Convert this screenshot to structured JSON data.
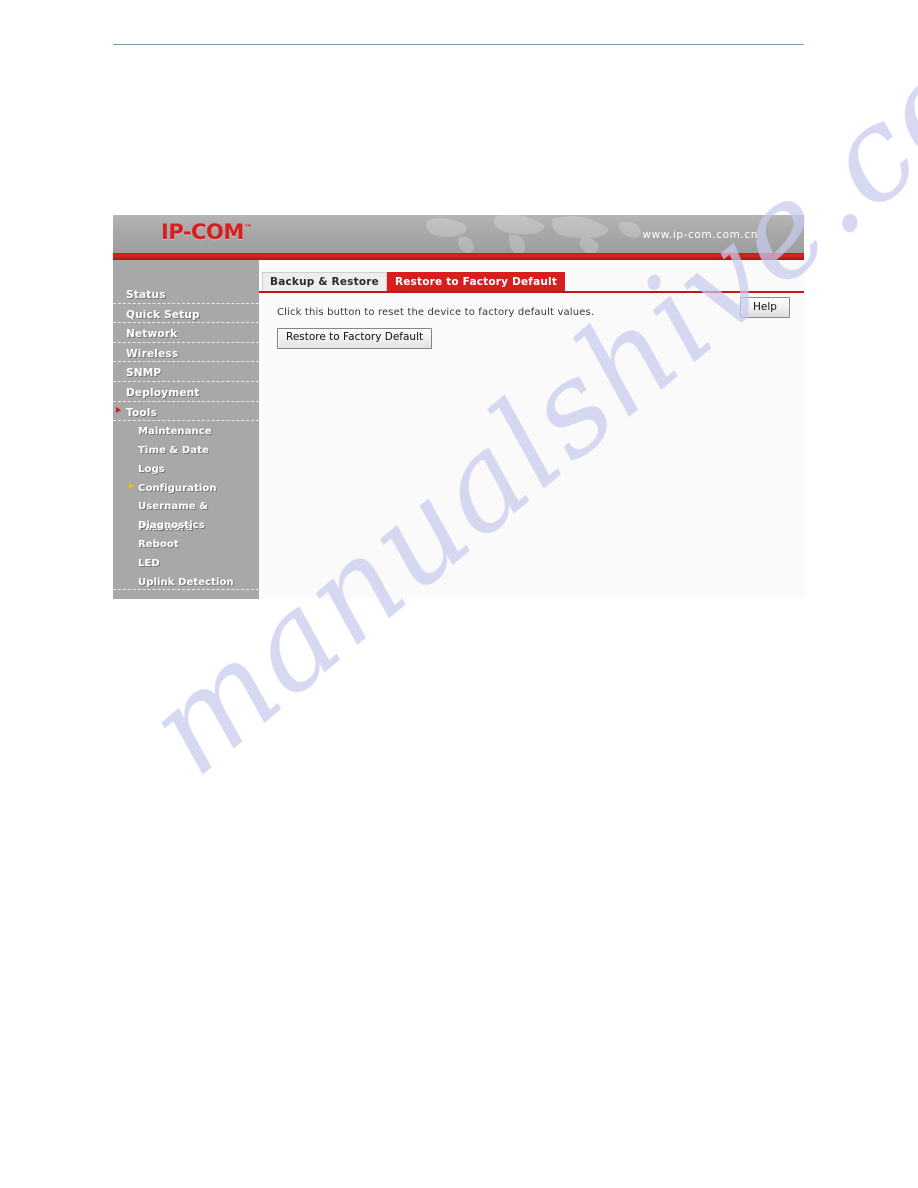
{
  "device_ui": {
    "header": {
      "logo_text": "IP-COM",
      "logo_tm": "™",
      "url": "www.ip-com.com.cn"
    },
    "sidebar": {
      "top_items": [
        {
          "label": "Status",
          "selected": false
        },
        {
          "label": "Quick Setup",
          "selected": false
        },
        {
          "label": "Network",
          "selected": false
        },
        {
          "label": "Wireless",
          "selected": false
        },
        {
          "label": "SNMP",
          "selected": false
        },
        {
          "label": "Deployment",
          "selected": false
        },
        {
          "label": "Tools",
          "selected": true
        }
      ],
      "sub_items": [
        {
          "label": "Maintenance",
          "selected": false
        },
        {
          "label": "Time & Date",
          "selected": false
        },
        {
          "label": "Logs",
          "selected": false
        },
        {
          "label": "Configuration",
          "selected": true
        },
        {
          "label": "Username & Password",
          "selected": false
        },
        {
          "label": "Diagnostics",
          "selected": false
        },
        {
          "label": "Reboot",
          "selected": false
        },
        {
          "label": "LED",
          "selected": false
        },
        {
          "label": "Uplink Detection",
          "selected": false
        }
      ]
    },
    "tabs": [
      {
        "label": "Backup & Restore",
        "active": false
      },
      {
        "label": "Restore to Factory Default",
        "active": true
      }
    ],
    "content": {
      "instruction": "Click this button to reset the device to factory default values.",
      "restore_button_label": "Restore to Factory Default",
      "help_button_label": "Help"
    },
    "colors": {
      "brand_red": "#d81f20",
      "accent_red": "#c41818",
      "sidebar_gray": "#a8a8a8",
      "selected_arrow_gold": "#f2c200"
    }
  },
  "page": {
    "watermark": "manualshive.com"
  }
}
